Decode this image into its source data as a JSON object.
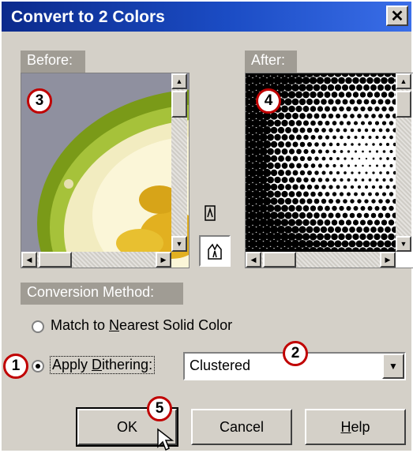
{
  "window": {
    "title": "Convert to 2 Colors",
    "close_icon": "close-icon"
  },
  "before": {
    "label": "Before:"
  },
  "after": {
    "label": "After:"
  },
  "conversion": {
    "label": "Conversion Method:",
    "option_nearest_pre": "Match to ",
    "option_nearest_u": "N",
    "option_nearest_post": "earest Solid Color",
    "option_dither_pre": "Apply ",
    "option_dither_u": "D",
    "option_dither_post": "ithering:",
    "selected_option": "Apply Dithering",
    "dither_value": "Clustered"
  },
  "buttons": {
    "ok": "OK",
    "cancel": "Cancel",
    "help_u": "H",
    "help_post": "elp"
  },
  "callouts": {
    "c1": "1",
    "c2": "2",
    "c3": "3",
    "c4": "4",
    "c5": "5"
  },
  "colors": {
    "title_start": "#0b2a8c",
    "title_end": "#3a6ee8",
    "callout_border": "#c00000",
    "face": "#d4d0c8"
  }
}
